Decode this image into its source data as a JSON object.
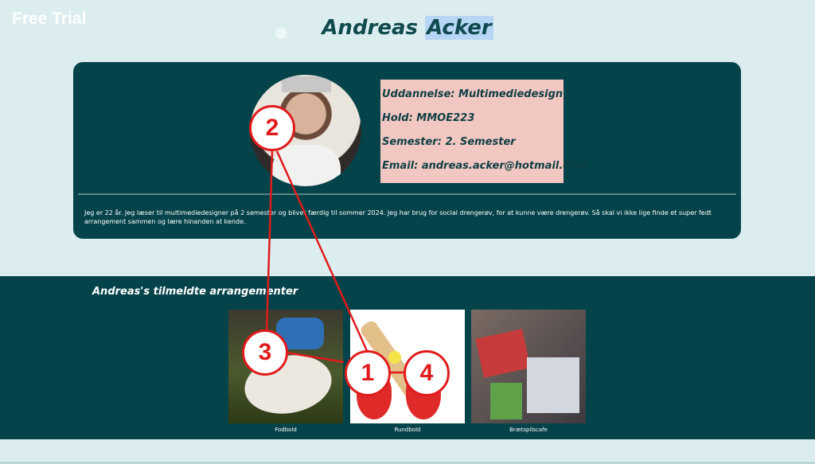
{
  "watermark": "Free Trial",
  "header": {
    "title_first": "Andreas",
    "title_last": "Acker"
  },
  "profile": {
    "info": [
      "Uddannelse: Multimediedesign",
      "Hold: MMOE223",
      "Semester: 2. Semester",
      "Email: andreas.acker@hotmail.com"
    ],
    "bio": "Jeg er 22 år. Jeg læser til multimediedesigner på 2 semester og bliver færdig til sommer 2024. Jeg har brug for social drengerøv, for at kunne være drengerøv. Så skal vi ikke lige finde et super fedt arrangement sammen og lære hinanden at kende."
  },
  "events": {
    "title": "Andreas's tilmeldte arrangementer",
    "items": [
      {
        "caption": "Fodbold"
      },
      {
        "caption": "Rundbold"
      },
      {
        "caption": "Brætspilscafe"
      }
    ]
  },
  "annotations": {
    "color": "#e01b1b",
    "markers": [
      "1",
      "2",
      "3",
      "4"
    ]
  },
  "colors": {
    "accent": "#044349",
    "info_bg": "#f3c7c1",
    "background": "#dcedef"
  }
}
